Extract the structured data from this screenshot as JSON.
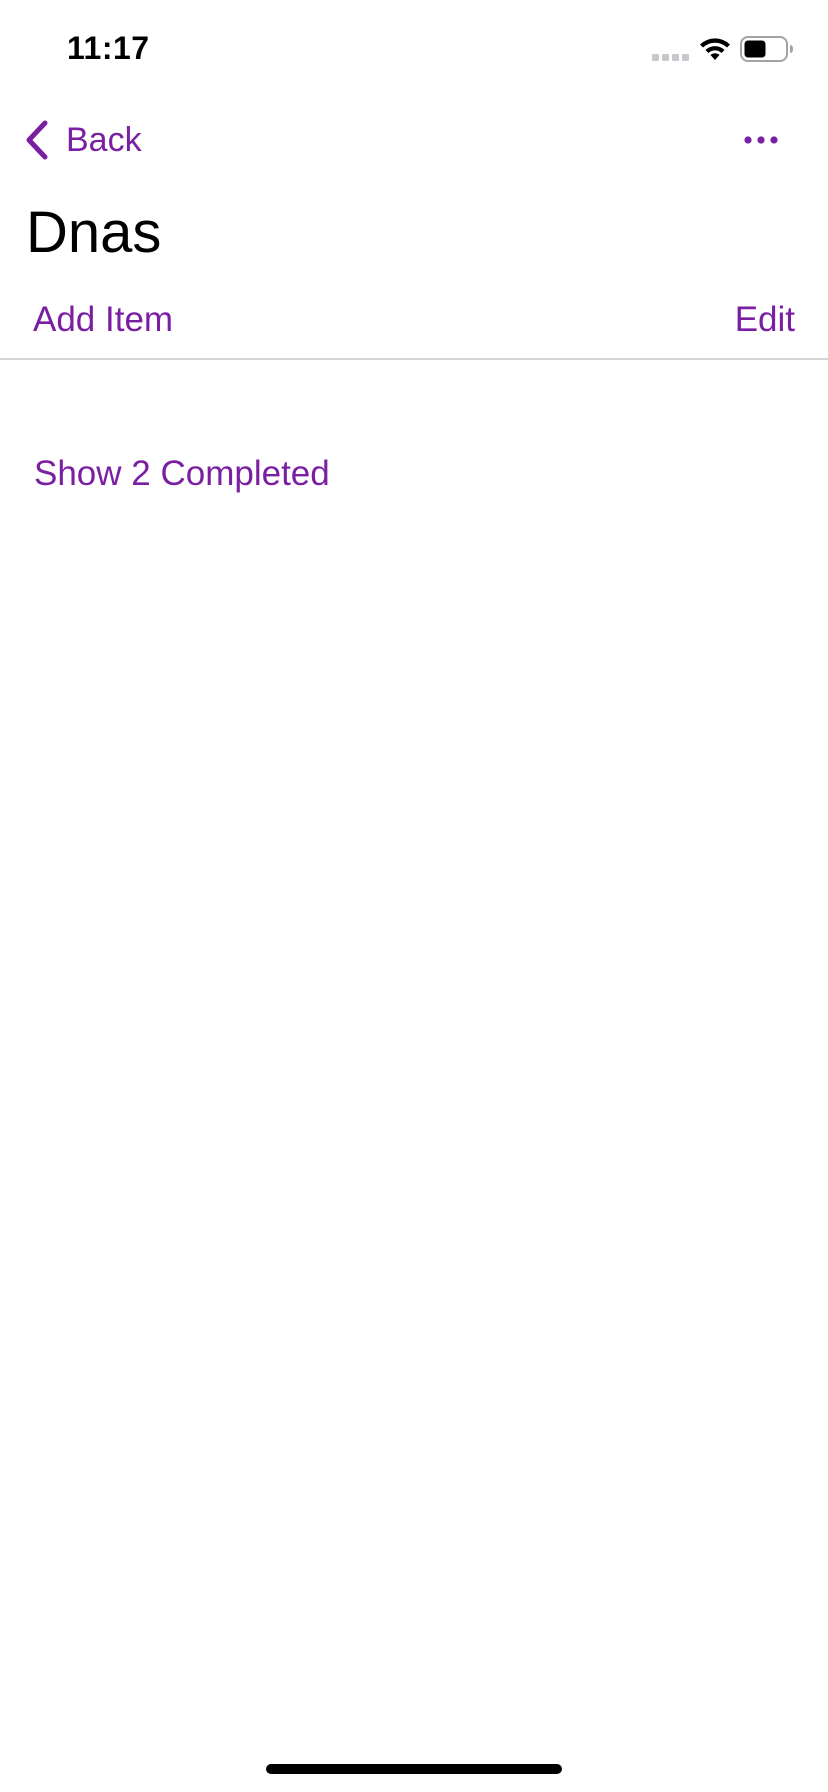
{
  "status_bar": {
    "time": "11:17"
  },
  "nav": {
    "back_label": "Back"
  },
  "list": {
    "title": "Dnas"
  },
  "toolbar": {
    "add_item_label": "Add Item",
    "edit_label": "Edit"
  },
  "completed": {
    "toggle_label": "Show 2 Completed"
  },
  "theme": {
    "accent": "#7b1fa2"
  },
  "icons": {
    "back": "chevron-left-icon",
    "more": "ellipsis-icon",
    "signal": "cellular-signal-icon",
    "wifi": "wifi-icon",
    "battery": "battery-icon"
  }
}
